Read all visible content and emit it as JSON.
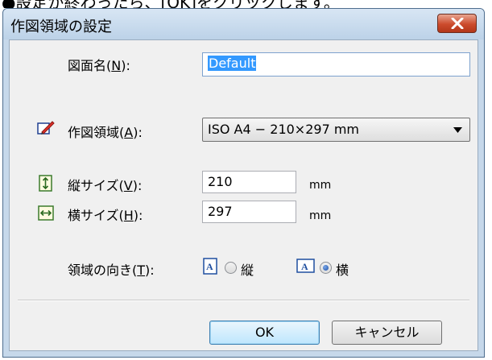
{
  "top_caption": "●設定が終わったら、[OK]をクリックします。",
  "dialog": {
    "title": "作図領域の設定",
    "drawing_name": {
      "label": "図面名(",
      "key": "N",
      "suffix": "):",
      "value": "Default"
    },
    "area": {
      "label": "作図領域(",
      "key": "A",
      "suffix": "):",
      "selected": "ISO A4 − 210×297 mm"
    },
    "height": {
      "label": "縦サイズ(",
      "key": "V",
      "suffix": "):",
      "value": "210",
      "unit": "mm"
    },
    "width": {
      "label": "横サイズ(",
      "key": "H",
      "suffix": "):",
      "value": "297",
      "unit": "mm"
    },
    "orientation": {
      "label": "領域の向き(",
      "key": "T",
      "suffix": "):",
      "portrait": "縦",
      "landscape": "横",
      "selected": "landscape"
    },
    "ok_label": "OK",
    "cancel_label": "キャンセル"
  },
  "colors": {
    "selection": "#3399ff",
    "close_button": "#cc4b2d",
    "title_bg": "#c6d8ea"
  }
}
